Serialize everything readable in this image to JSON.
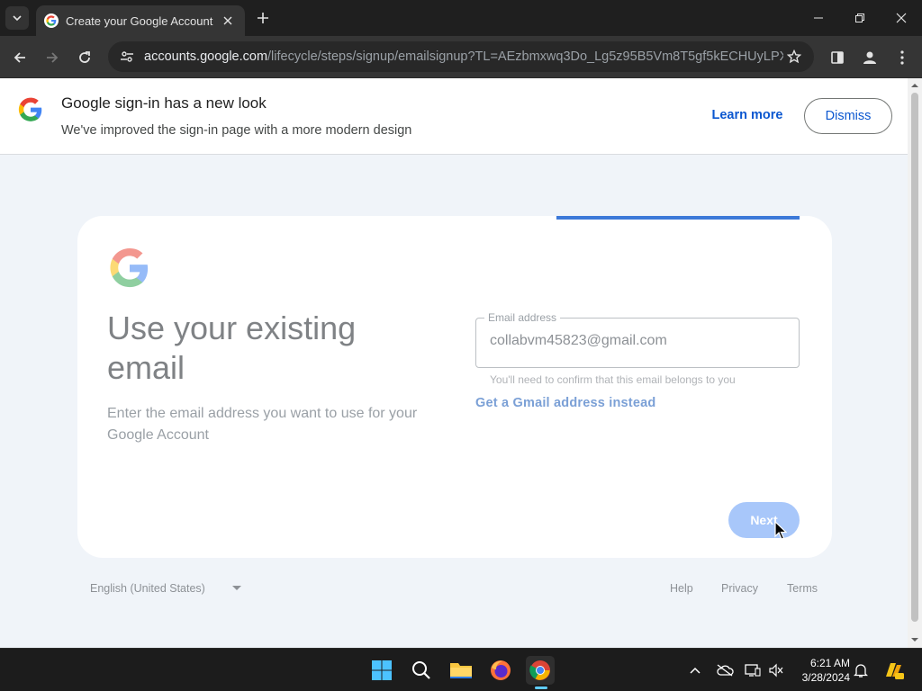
{
  "browser": {
    "tab_title": "Create your Google Account",
    "url_host": "accounts.google.com",
    "url_path": "/lifecycle/steps/signup/emailsignup?TL=AEzbmxwq3Do_Lg5z95B5Vm8T5gf5kECHUyLPXKbz..."
  },
  "banner": {
    "title": "Google sign-in has a new look",
    "subtitle": "We've improved the sign-in page with a more modern design",
    "learn_more": "Learn more",
    "dismiss": "Dismiss"
  },
  "form": {
    "headline": "Use your existing email",
    "description": "Enter the email address you want to use for your Google Account",
    "email_label": "Email address",
    "email_value": "collabvm45823@gmail.com",
    "hint": "You'll need to confirm that this email belongs to you",
    "gmail_link": "Get a Gmail address instead",
    "next": "Next"
  },
  "footer": {
    "language": "English (United States)",
    "help": "Help",
    "privacy": "Privacy",
    "terms": "Terms"
  },
  "taskbar": {
    "time": "6:21 AM",
    "date": "3/28/2024"
  },
  "colors": {
    "accent": "#0b57d0",
    "next_disabled": "#a8c7fa",
    "page_bg": "#f0f4f9"
  }
}
